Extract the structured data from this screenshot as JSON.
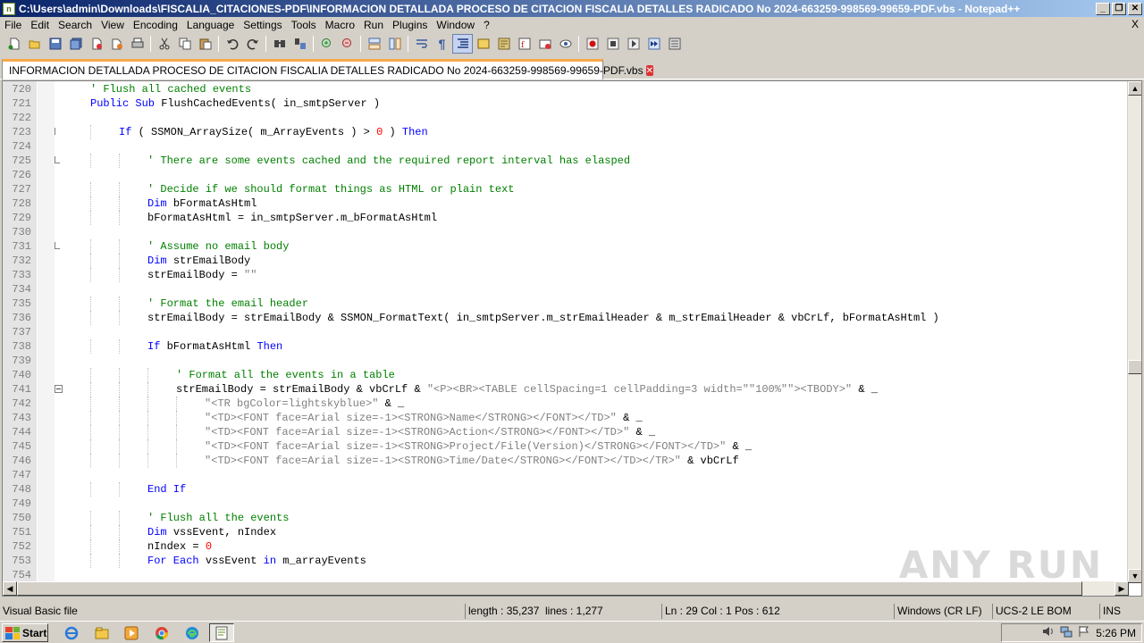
{
  "window": {
    "title": "C:\\Users\\admin\\Downloads\\FISCALIA_CITACIONES-PDF\\INFORMACION DETALLADA PROCESO DE CITACION FISCALIA DETALLES RADICADO No 2024-663259-998569-99659-PDF.vbs - Notepad++",
    "minimize": "_",
    "restore": "❐",
    "close": "✕"
  },
  "menu": {
    "items": [
      "File",
      "Edit",
      "Search",
      "View",
      "Encoding",
      "Language",
      "Settings",
      "Tools",
      "Macro",
      "Run",
      "Plugins",
      "Window",
      "?"
    ],
    "close_doc": "X"
  },
  "toolbar": {
    "icons": [
      "new-file-icon",
      "open-file-icon",
      "save-icon",
      "save-all-icon",
      "close-icon",
      "close-all-icon",
      "print-icon",
      "cut-icon",
      "copy-icon",
      "paste-icon",
      "undo-icon",
      "redo-icon",
      "find-icon",
      "replace-icon",
      "zoom-in-icon",
      "zoom-out-icon",
      "sync-vertical-icon",
      "sync-horizontal-icon",
      "word-wrap-icon",
      "show-all-chars-icon",
      "indent-guide-icon",
      "udl-icon",
      "doc-map-icon",
      "function-list-icon",
      "folder-as-workspace-icon",
      "monitoring-icon",
      "record-macro-icon",
      "stop-macro-icon",
      "play-macro-icon",
      "run-macro-multiple-icon",
      "save-macro-icon"
    ]
  },
  "tab": {
    "label": "INFORMACION DETALLADA PROCESO DE CITACION FISCALIA DETALLES RADICADO No 2024-663259-998569-99659-PDF.vbs",
    "close": "✕"
  },
  "editor": {
    "lines": [
      {
        "n": "720",
        "indent": 1,
        "tokens": [
          [
            "c-comment",
            "' Flush all cached events"
          ]
        ]
      },
      {
        "n": "721",
        "indent": 1,
        "tokens": [
          [
            "c-kw",
            "Public Sub "
          ],
          [
            "c-op",
            "FlushCachedEvents( in_smtpServer )"
          ]
        ]
      },
      {
        "n": "722",
        "indent": 0,
        "tokens": []
      },
      {
        "n": "723",
        "indent": 2,
        "tokens": [
          [
            "c-kw",
            "If "
          ],
          [
            "c-op",
            "( SSMON_ArraySize( m_ArrayEvents ) > "
          ],
          [
            "c-num",
            "0"
          ],
          [
            "c-op",
            " ) "
          ],
          [
            "c-kw",
            "Then"
          ]
        ]
      },
      {
        "n": "724",
        "indent": 0,
        "tokens": []
      },
      {
        "n": "725",
        "indent": 3,
        "tokens": [
          [
            "c-comment",
            "' There are some events cached and the required report interval has elasped"
          ]
        ]
      },
      {
        "n": "726",
        "indent": 0,
        "tokens": []
      },
      {
        "n": "727",
        "indent": 3,
        "tokens": [
          [
            "c-comment",
            "' Decide if we should format things as HTML or plain text"
          ]
        ]
      },
      {
        "n": "728",
        "indent": 3,
        "tokens": [
          [
            "c-kw",
            "Dim "
          ],
          [
            "c-op",
            "bFormatAsHtml"
          ]
        ]
      },
      {
        "n": "729",
        "indent": 3,
        "tokens": [
          [
            "c-op",
            "bFormatAsHtml = in_smtpServer.m_bFormatAsHtml"
          ]
        ]
      },
      {
        "n": "730",
        "indent": 0,
        "tokens": []
      },
      {
        "n": "731",
        "indent": 3,
        "tokens": [
          [
            "c-comment",
            "' Assume no email body"
          ]
        ]
      },
      {
        "n": "732",
        "indent": 3,
        "tokens": [
          [
            "c-kw",
            "Dim "
          ],
          [
            "c-op",
            "strEmailBody"
          ]
        ]
      },
      {
        "n": "733",
        "indent": 3,
        "tokens": [
          [
            "c-op",
            "strEmailBody = "
          ],
          [
            "c-str",
            "\"\""
          ]
        ]
      },
      {
        "n": "734",
        "indent": 0,
        "tokens": []
      },
      {
        "n": "735",
        "indent": 3,
        "tokens": [
          [
            "c-comment",
            "' Format the email header"
          ]
        ]
      },
      {
        "n": "736",
        "indent": 3,
        "tokens": [
          [
            "c-op",
            "strEmailBody = strEmailBody & SSMON_FormatText( in_smtpServer.m_strEmailHeader & m_strEmailHeader & vbCrLf, bFormatAsHtml )"
          ]
        ]
      },
      {
        "n": "737",
        "indent": 0,
        "tokens": []
      },
      {
        "n": "738",
        "indent": 3,
        "tokens": [
          [
            "c-kw",
            "If "
          ],
          [
            "c-op",
            "bFormatAsHtml "
          ],
          [
            "c-kw",
            "Then"
          ]
        ]
      },
      {
        "n": "739",
        "indent": 0,
        "tokens": []
      },
      {
        "n": "740",
        "indent": 4,
        "tokens": [
          [
            "c-comment",
            "' Format all the events in a table"
          ]
        ]
      },
      {
        "n": "741",
        "indent": 4,
        "tokens": [
          [
            "c-op",
            "strEmailBody = strEmailBody & vbCrLf & "
          ],
          [
            "c-str",
            "\"<P><BR><TABLE cellSpacing=1 cellPadding=3 width=\"\"100%\"\"><TBODY>\""
          ],
          [
            "c-op",
            " & _"
          ]
        ]
      },
      {
        "n": "742",
        "indent": 5,
        "tokens": [
          [
            "c-str",
            "\"<TR bgColor=lightskyblue>\""
          ],
          [
            "c-op",
            " & _"
          ]
        ]
      },
      {
        "n": "743",
        "indent": 5,
        "tokens": [
          [
            "c-str",
            "\"<TD><FONT face=Arial size=-1><STRONG>Name</STRONG></FONT></TD>\""
          ],
          [
            "c-op",
            " & _"
          ]
        ]
      },
      {
        "n": "744",
        "indent": 5,
        "tokens": [
          [
            "c-str",
            "\"<TD><FONT face=Arial size=-1><STRONG>Action</STRONG></FONT></TD>\""
          ],
          [
            "c-op",
            " & _"
          ]
        ]
      },
      {
        "n": "745",
        "indent": 5,
        "tokens": [
          [
            "c-str",
            "\"<TD><FONT face=Arial size=-1><STRONG>Project/File(Version)</STRONG></FONT></TD>\""
          ],
          [
            "c-op",
            " & _"
          ]
        ]
      },
      {
        "n": "746",
        "indent": 5,
        "tokens": [
          [
            "c-str",
            "\"<TD><FONT face=Arial size=-1><STRONG>Time/Date</STRONG></FONT></TD></TR>\""
          ],
          [
            "c-op",
            " & vbCrLf"
          ]
        ]
      },
      {
        "n": "747",
        "indent": 0,
        "tokens": []
      },
      {
        "n": "748",
        "indent": 3,
        "tokens": [
          [
            "c-kw",
            "End If"
          ]
        ]
      },
      {
        "n": "749",
        "indent": 0,
        "tokens": []
      },
      {
        "n": "750",
        "indent": 3,
        "tokens": [
          [
            "c-comment",
            "' Flush all the events"
          ]
        ]
      },
      {
        "n": "751",
        "indent": 3,
        "tokens": [
          [
            "c-kw",
            "Dim "
          ],
          [
            "c-op",
            "vssEvent, nIndex"
          ]
        ]
      },
      {
        "n": "752",
        "indent": 3,
        "tokens": [
          [
            "c-op",
            "nIndex = "
          ],
          [
            "c-num",
            "0"
          ]
        ]
      },
      {
        "n": "753",
        "indent": 3,
        "tokens": [
          [
            "c-kw",
            "For Each "
          ],
          [
            "c-op",
            "vssEvent "
          ],
          [
            "c-kw",
            "in "
          ],
          [
            "c-op",
            "m_arrayEvents"
          ]
        ]
      },
      {
        "n": "754",
        "indent": 0,
        "tokens": []
      }
    ]
  },
  "watermark": "ANY RUN",
  "status": {
    "file_type": "Visual Basic file",
    "length": "length : 35,237",
    "lines": "lines : 1,277",
    "position": "Ln : 29    Col : 1    Pos : 612",
    "eol": "Windows (CR LF)",
    "encoding": "UCS-2 LE BOM",
    "mode": "INS"
  },
  "taskbar": {
    "start": "Start",
    "clock": "5:26 PM"
  },
  "colors": {
    "title_start": "#0a246a",
    "title_end": "#a6caf0",
    "comment": "#008000",
    "keyword": "#0000ff",
    "string": "#808080",
    "number": "#ff0000",
    "tab_accent": "#f9a94b"
  }
}
